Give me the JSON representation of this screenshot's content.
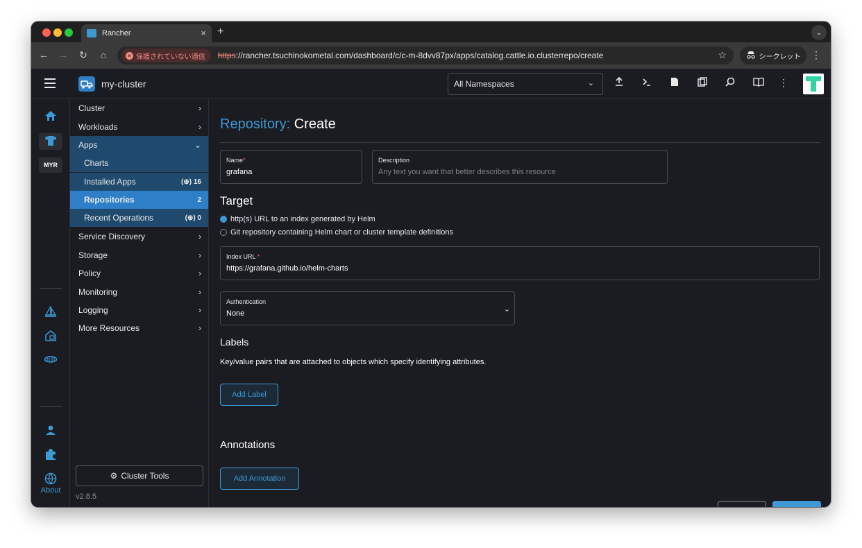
{
  "browser": {
    "tab_title": "Rancher",
    "tab_close": "×",
    "new_tab": "+",
    "tab_menu": "⌄",
    "back": "←",
    "forward": "→",
    "reload": "↻",
    "home": "⌂",
    "security_label": "保護されていない通信",
    "url_scheme": "https",
    "url_rest": "://rancher.tsuchinokometal.com/dashboard/c/c-m-8dvv87px/apps/catalog.cattle.io.clusterrepo/create",
    "bookmark": "☆",
    "incognito_label": "シークレット",
    "menu": "⋮"
  },
  "header": {
    "cluster_name": "my-cluster",
    "namespace_select": "All Namespaces"
  },
  "rail": {
    "myr": "MYR",
    "about": "About"
  },
  "sidebar": {
    "cluster": "Cluster",
    "workloads": "Workloads",
    "apps": "Apps",
    "charts": "Charts",
    "installed_apps": "Installed Apps",
    "installed_apps_count": "(⊕) 16",
    "repositories": "Repositories",
    "repositories_count": "2",
    "recent_operations": "Recent Operations",
    "recent_operations_count": "(⊕) 0",
    "service_discovery": "Service Discovery",
    "storage": "Storage",
    "policy": "Policy",
    "monitoring": "Monitoring",
    "logging": "Logging",
    "more_resources": "More Resources",
    "cluster_tools": "Cluster Tools",
    "version": "v2.8.5"
  },
  "main": {
    "title_crumb": "Repository:",
    "title_action": "Create",
    "name_label": "Name",
    "name_value": "grafana",
    "description_label": "Description",
    "description_placeholder": "Any text you want that better describes this resource",
    "target_heading": "Target",
    "target_option_helm": "http(s) URL to an index generated by Helm",
    "target_option_git": "Git repository containing Helm chart or cluster template definitions",
    "index_url_label": "Index URL",
    "index_url_value": "https://grafana.github.io/helm-charts",
    "auth_label": "Authentication",
    "auth_value": "None",
    "labels_heading": "Labels",
    "labels_description": "Key/value pairs that are attached to objects which specify identifying attributes.",
    "add_label_button": "Add Label",
    "annotations_heading": "Annotations",
    "add_annotation_button": "Add Annotation"
  },
  "colors": {
    "accent": "#3d98d3",
    "background": "#1b1c21",
    "sidebar_active": "#2f7fc8",
    "sidebar_group": "#1f4a6e"
  }
}
